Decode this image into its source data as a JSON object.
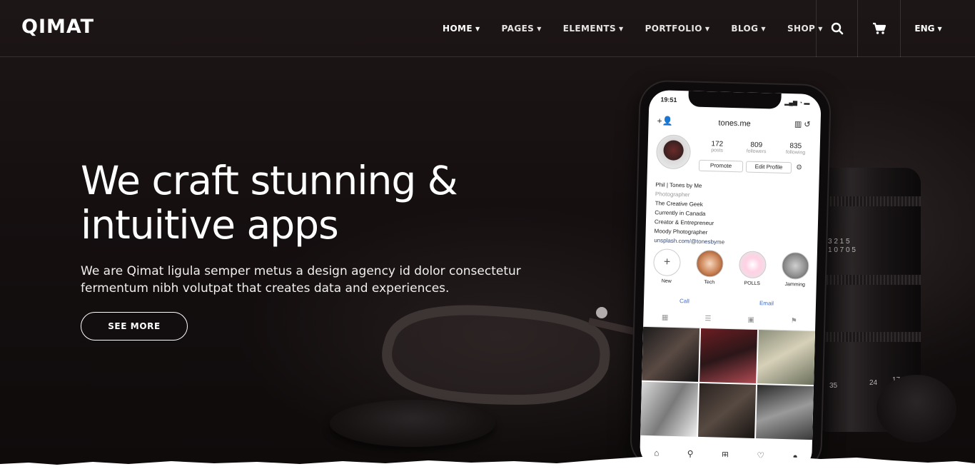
{
  "brand": {
    "logo": "QIMAT"
  },
  "nav": {
    "items": [
      {
        "label": "HOME",
        "active": true
      },
      {
        "label": "PAGES",
        "active": false
      },
      {
        "label": "ELEMENTS",
        "active": false
      },
      {
        "label": "PORTFOLIO",
        "active": false
      },
      {
        "label": "BLOG",
        "active": false
      },
      {
        "label": "SHOP",
        "active": false
      }
    ],
    "language": "ENG",
    "icons": [
      "search-icon",
      "cart-icon",
      "chevron-down-icon"
    ]
  },
  "hero": {
    "headline_line1": "We craft stunning &",
    "headline_line2": "intuitive apps",
    "subtext_line1": "We are Qimat ligula semper metus a design agency id dolor consectetur",
    "subtext_line2": "fermentum nibh volutpat that creates data and experiences.",
    "cta_label": "SEE MORE"
  },
  "phone_screen": {
    "time": "19:51",
    "username": "tones.me",
    "posts": "172",
    "posts_label": "posts",
    "followers": "809",
    "followers_label": "followers",
    "following": "835",
    "following_label": "following",
    "promote": "Promote",
    "edit_profile": "Edit Profile",
    "bio_name": "Phil | Tones by Me",
    "bio_role": "Photographer",
    "bio_1": "The Creative Geek",
    "bio_2": "Currently in Canada",
    "bio_3": "Creator & Entrepreneur",
    "bio_4": "Moody Photographer",
    "bio_link": "unsplash.com/@tonesbyme",
    "highlights": [
      "New",
      "Tech",
      "POLLS",
      "Jamming"
    ],
    "call": "Call",
    "email": "Email"
  },
  "lens_text": {
    "a": "3  2  1 5",
    "b": "1  0 7 0 5",
    "c": "35",
    "d": "24",
    "e": "17"
  },
  "colors": {
    "background": "#150f10",
    "text": "#ffffff",
    "link": "#3a6bd1"
  }
}
